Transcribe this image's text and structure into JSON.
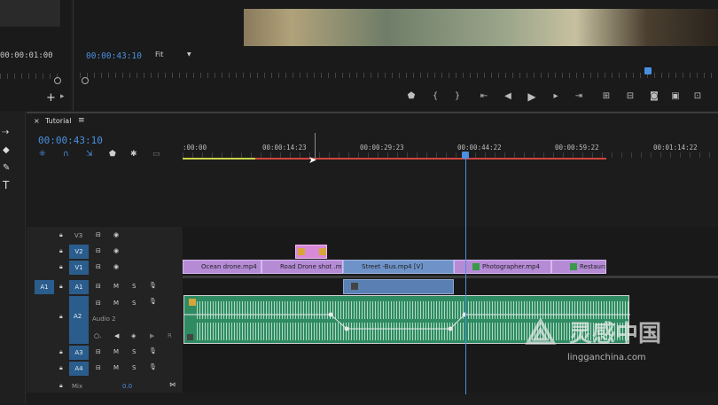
{
  "source_monitor": {
    "timecode": "00:00:01:00"
  },
  "program_monitor": {
    "timecode": "00:00:43:10",
    "fit_label": "Fit"
  },
  "timeline": {
    "sequence_tab": "Tutorial",
    "timecode": "00:00:43:10",
    "ruler_labels": [
      ":00:00",
      "00:00:14:23",
      "00:00:29:23",
      "00:00:44:22",
      "00:00:59:22",
      "00:01:14:22"
    ],
    "video_tracks": [
      {
        "name": "V3"
      },
      {
        "name": "V2"
      },
      {
        "name": "V1"
      }
    ],
    "audio_tracks": [
      {
        "name": "A1",
        "source": "A1"
      },
      {
        "name": "A2",
        "track_name": "Audio 2"
      },
      {
        "name": "A3"
      },
      {
        "name": "A4"
      }
    ],
    "clips_v1": [
      {
        "label": "Ocean drone.mp4"
      },
      {
        "label": "Road Drone shot .mp"
      },
      {
        "label": "Street -Bus.mp4 [V]"
      },
      {
        "label": "Photographer.mp4"
      },
      {
        "label": "Restaurant."
      }
    ],
    "mix_label": "Mix",
    "mix_value": "0.0",
    "track_buttons": {
      "m": "M",
      "s": "S",
      "r": "R"
    }
  },
  "watermark": {
    "text": "灵感中国",
    "url": "lingganchina.com"
  },
  "colors": {
    "timecode_blue": "#4a8fe0",
    "v_clip": "#b58bd6",
    "audio_clip": "#2e8b62",
    "playhead": "#4a8fe0"
  }
}
